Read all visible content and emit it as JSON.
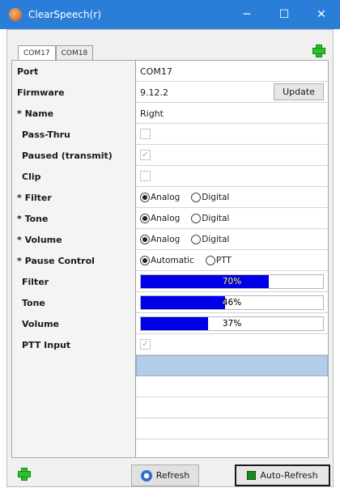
{
  "window": {
    "title": "ClearSpeech(r)",
    "minimize_glyph": "─",
    "maximize_glyph": "☐",
    "close_glyph": "✕"
  },
  "tabs": [
    {
      "label": "COM17",
      "active": true
    },
    {
      "label": "COM18",
      "active": false
    }
  ],
  "icons": {
    "app": "app-icon",
    "add_top": "plus-icon",
    "add_bottom": "plus-icon",
    "refresh": "refresh-icon",
    "auto_refresh": "green-square-icon"
  },
  "properties": {
    "port": {
      "label": "Port",
      "value": "COM17"
    },
    "firmware": {
      "label": "Firmware",
      "value": "9.12.2",
      "button": "Update"
    },
    "name": {
      "label": "* Name",
      "value": "Right"
    },
    "pass_thru": {
      "label": "Pass-Thru",
      "checked": false
    },
    "paused": {
      "label": "Paused (transmit)",
      "checked": true
    },
    "clip": {
      "label": "Clip",
      "checked": false
    },
    "filter": {
      "label": "* Filter",
      "options": [
        "Analog",
        "Digital"
      ],
      "selected": "Analog"
    },
    "tone": {
      "label": "* Tone",
      "options": [
        "Analog",
        "Digital"
      ],
      "selected": "Analog"
    },
    "volume": {
      "label": "* Volume",
      "options": [
        "Analog",
        "Digital"
      ],
      "selected": "Analog"
    },
    "pause_control": {
      "label": "* Pause Control",
      "options": [
        "Automatic",
        "PTT"
      ],
      "selected": "Automatic"
    },
    "filter_level": {
      "label": "Filter",
      "percent": 70,
      "text": "70%"
    },
    "tone_level": {
      "label": "Tone",
      "percent": 46,
      "text": "46%"
    },
    "volume_level": {
      "label": "Volume",
      "percent": 37,
      "text": "37%"
    },
    "ptt_input": {
      "label": "PTT Input",
      "checked": true
    }
  },
  "buttons": {
    "refresh": "Refresh",
    "auto_refresh": "Auto-Refresh"
  },
  "colors": {
    "titlebar": "#2a7ed8",
    "progress": "#0000e8",
    "selection": "#b4cde6",
    "add": "#2dbf2d"
  }
}
